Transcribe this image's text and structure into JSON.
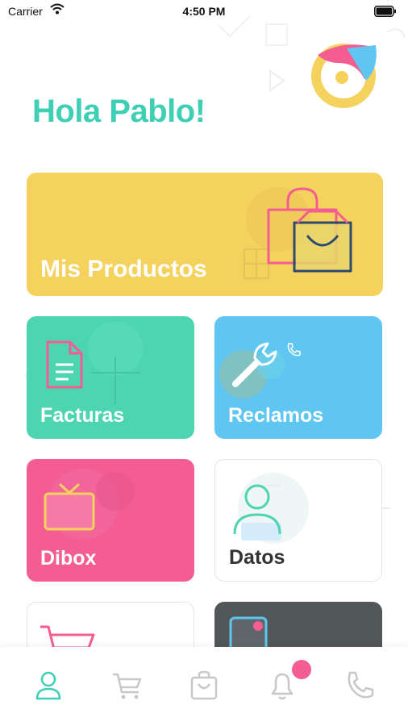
{
  "status_bar": {
    "carrier": "Carrier",
    "time": "4:50 PM"
  },
  "greeting": "Hola Pablo!",
  "cards": {
    "productos": {
      "label": "Mis Productos",
      "icon": "shopping-bags-icon",
      "color": "#f5d25d"
    },
    "facturas": {
      "label": "Facturas",
      "icon": "document-icon",
      "color": "#4dd4b0"
    },
    "reclamos": {
      "label": "Reclamos",
      "icon": "wrench-icon",
      "color": "#5ec6f1"
    },
    "dibox": {
      "label": "Dibox",
      "icon": "tv-icon",
      "color": "#f45d92"
    },
    "datos": {
      "label": "Datos",
      "icon": "user-icon",
      "color": "#ffffff"
    },
    "tienda": {
      "label": "",
      "icon": "cart-icon",
      "color": "#ffffff"
    },
    "tarjeta": {
      "label": "",
      "icon": "card-icon",
      "color": "#525759"
    }
  },
  "tabbar": {
    "items": [
      {
        "name": "profile",
        "icon": "user-icon",
        "active": true
      },
      {
        "name": "cart",
        "icon": "cart-icon",
        "active": false
      },
      {
        "name": "bag",
        "icon": "bag-icon",
        "active": false
      },
      {
        "name": "notifications",
        "icon": "bell-icon",
        "active": false,
        "badge": true
      },
      {
        "name": "phone",
        "icon": "phone-icon",
        "active": false
      }
    ],
    "active_color": "#3ecfb4",
    "inactive_color": "#c8c8c8"
  }
}
